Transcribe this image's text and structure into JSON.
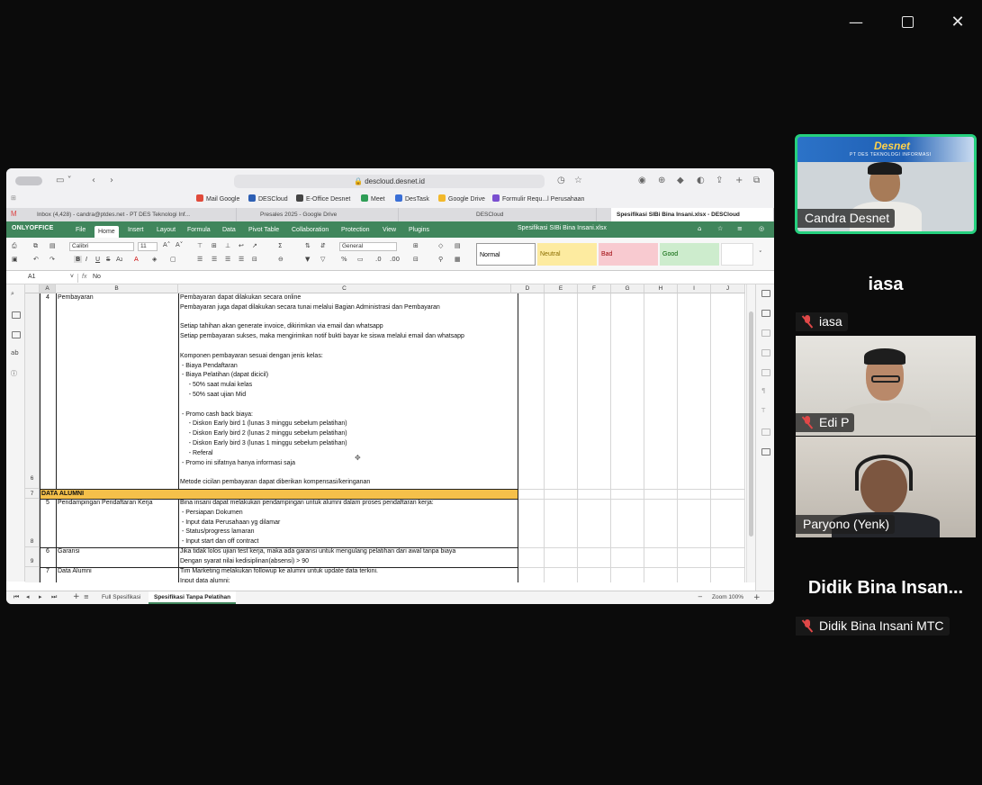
{
  "browser": {
    "url": "descloud.desnet.id",
    "bookmarks": [
      "Mail Google",
      "DESCloud",
      "E-Office Desnet",
      "Meet",
      "DesTask",
      "Google Drive",
      "Formulir Requ...l Perusahaan"
    ],
    "tabs": [
      "Inbox (4,428) - candra@ptdes.net - PT DES Teknologi Inf...",
      "Presales 2025 - Google Drive",
      "DESCloud",
      "Spesifikasi SIBi Bina Insani.xlsx - DESCloud"
    ]
  },
  "app": {
    "logo": "ONLYOFFICE",
    "menu": [
      "File",
      "Home",
      "Insert",
      "Layout",
      "Formula",
      "Data",
      "Pivot Table",
      "Collaboration",
      "Protection",
      "View",
      "Plugins"
    ],
    "active_menu": "Home",
    "doc_title": "Spesifikasi SIBi Bina Insani.xlsx"
  },
  "toolbar": {
    "font": "Calibri",
    "font_size": "11",
    "number_format": "General",
    "styles": [
      "Normal",
      "Neutral",
      "Bad",
      "Good"
    ]
  },
  "formula_bar": {
    "cell_ref": "A1",
    "fx": "fx",
    "content": "No"
  },
  "columns": [
    "A",
    "B",
    "C",
    "D",
    "E",
    "F",
    "G",
    "H",
    "I",
    "J"
  ],
  "rows": {
    "r6": {
      "header": "6",
      "a": "4",
      "b": "Pembayaran",
      "c_lines": [
        "Pembayaran dapat dilakukan secara online",
        "Pembayaran juga dapat dilakukan secara tunai melalui Bagian Administrasi dan Pembayaran",
        "",
        "Setiap tahihan akan generate invoice, dikirimkan via email dan whatsapp",
        "Setiap pembayaran sukses, maka mengirimkan notif bukti bayar ke siswa melalui email dan whatsapp",
        "",
        "Komponen pembayaran sesuai dengan jenis kelas:",
        " - Biaya Pendaftaran",
        " - Biaya Pelatihan (dapat dicicil)",
        "     - 50% saat mulai kelas",
        "     - 50% saat ujian Mid",
        "",
        " - Promo cash back biaya:",
        "     - Diskon Early bird 1 (lunas 3 minggu sebelum pelatihan)",
        "     - Diskon Early bird 2 (lunas 2 minggu sebelum pelatihan)",
        "     - Diskon Early bird 3 (lunas 1 minggu sebelum pelatihan)",
        "     - Referal",
        " - Promo ini sifatnya hanya informasi saja",
        "",
        "Metode cicilan pembayaran dapat diberikan kompensasi/keringanan"
      ]
    },
    "r7": {
      "header": "7",
      "a": "DATA ALUMNI"
    },
    "r8": {
      "header": "8",
      "a": "5",
      "b": "Pendampingan Pendaftaran Kerja",
      "c_lines": [
        "Bina insani dapat melakukan pendampingan untuk alumni dalam proses pendaftaran kerja:",
        " - Persiapan Dokumen",
        " - Input data Perusahaan yg dilamar",
        " - Status/progress lamaran",
        " - Input start dan off contract"
      ]
    },
    "r9": {
      "header": "9",
      "a": "6",
      "b": "Garansi",
      "c_lines": [
        "Jika tidak lolos ujian test kerja, maka ada garansi untuk mengulang pelatihan dari awal tanpa biaya",
        "Dengan syarat nilai kedisiplinan(absensi) > 90"
      ]
    },
    "r10": {
      "a": "7",
      "b": "Data Alumni",
      "c_lines": [
        "Tim Marketing melakukan followup ke alumni untuk update data terkini.",
        "Input data alumni:"
      ]
    }
  },
  "sheets": [
    "Full Spesifikasi",
    "Spesifikasi Tanpa Pelatihan"
  ],
  "active_sheet": "Spesifikasi Tanpa Pelatihan",
  "zoom": "Zoom 100%",
  "participants": [
    {
      "name": "Candra Desnet",
      "muted": false,
      "banner": "Desnet",
      "banner_sub": "PT DES TEKNOLOGI INFORMASI"
    },
    {
      "name": "iasa",
      "muted": true,
      "center_name": "iasa"
    },
    {
      "name": "Edi P",
      "muted": true
    },
    {
      "name": "Paryono (Yenk)",
      "muted": false
    },
    {
      "name": "Didik Bina Insani MTC",
      "muted": true,
      "center_name": "Didik Bina Insan..."
    }
  ]
}
